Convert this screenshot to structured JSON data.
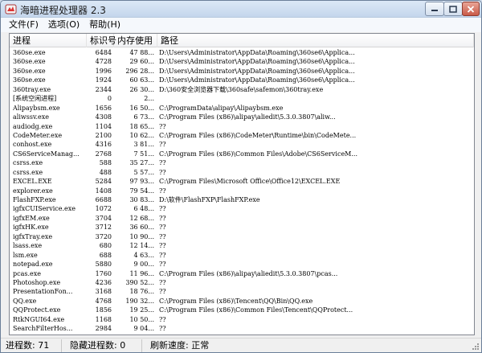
{
  "window": {
    "title": "海暗进程处理器 2.3"
  },
  "menu": {
    "items": [
      "文件(F)",
      "选项(O)",
      "帮助(H)"
    ]
  },
  "columns": {
    "name": "进程",
    "pid": "标识号",
    "mem": "内存使用",
    "path": "路径"
  },
  "rows": [
    {
      "name": "360se.exe",
      "pid": "6484",
      "mem": "47 88...",
      "path": "D:\\Users\\Administrator\\AppData\\Roaming\\360se6\\Applica..."
    },
    {
      "name": "360se.exe",
      "pid": "4728",
      "mem": "29 60...",
      "path": "D:\\Users\\Administrator\\AppData\\Roaming\\360se6\\Applica..."
    },
    {
      "name": "360se.exe",
      "pid": "1996",
      "mem": "296 28...",
      "path": "D:\\Users\\Administrator\\AppData\\Roaming\\360se6\\Applica..."
    },
    {
      "name": "360se.exe",
      "pid": "1924",
      "mem": "60 63...",
      "path": "D:\\Users\\Administrator\\AppData\\Roaming\\360se6\\Applica..."
    },
    {
      "name": "360tray.exe",
      "pid": "2344",
      "mem": "26 30...",
      "path": "D:\\360安全浏览器下载\\360safe\\safemon\\360tray.exe"
    },
    {
      "name": "[系统空闲进程]",
      "pid": "0",
      "mem": "2...",
      "path": ""
    },
    {
      "name": "Alipaybsm.exe",
      "pid": "1656",
      "mem": "16 50...",
      "path": "C:\\ProgramData\\alipay\\Alipaybsm.exe"
    },
    {
      "name": "aliwssv.exe",
      "pid": "4308",
      "mem": "6 73...",
      "path": "C:\\Program Files (x86)\\alipay\\aliedit\\5.3.0.3807\\aliw..."
    },
    {
      "name": "audiodg.exe",
      "pid": "1104",
      "mem": "18 65...",
      "path": "??"
    },
    {
      "name": "CodeMeter.exe",
      "pid": "2100",
      "mem": "10 62...",
      "path": "C:\\Program Files (x86)\\CodeMeter\\Runtime\\bin\\CodeMete..."
    },
    {
      "name": "conhost.exe",
      "pid": "4316",
      "mem": "3 81...",
      "path": "??"
    },
    {
      "name": "CS6ServiceManag...",
      "pid": "2768",
      "mem": "7 51...",
      "path": "C:\\Program Files (x86)\\Common Files\\Adobe\\CS6ServiceM..."
    },
    {
      "name": "csrss.exe",
      "pid": "588",
      "mem": "35 27...",
      "path": "??"
    },
    {
      "name": "csrss.exe",
      "pid": "488",
      "mem": "5 57...",
      "path": "??"
    },
    {
      "name": "EXCEL.EXE",
      "pid": "5284",
      "mem": "97 93...",
      "path": "C:\\Program Files\\Microsoft Office\\Office12\\EXCEL.EXE"
    },
    {
      "name": "explorer.exe",
      "pid": "1408",
      "mem": "79 54...",
      "path": "??"
    },
    {
      "name": "FlashFXP.exe",
      "pid": "6688",
      "mem": "30 83...",
      "path": "D:\\软件\\FlashFXP\\FlashFXP.exe"
    },
    {
      "name": "igfxCUIService.exe",
      "pid": "1072",
      "mem": "6 48...",
      "path": "??"
    },
    {
      "name": "igfxEM.exe",
      "pid": "3704",
      "mem": "12 68...",
      "path": "??"
    },
    {
      "name": "igfxHK.exe",
      "pid": "3712",
      "mem": "36 60...",
      "path": "??"
    },
    {
      "name": "igfxTray.exe",
      "pid": "3720",
      "mem": "10 90...",
      "path": "??"
    },
    {
      "name": "lsass.exe",
      "pid": "680",
      "mem": "12 14...",
      "path": "??"
    },
    {
      "name": "lsm.exe",
      "pid": "688",
      "mem": "4 63...",
      "path": "??"
    },
    {
      "name": "notepad.exe",
      "pid": "5880",
      "mem": "9 00...",
      "path": "??"
    },
    {
      "name": "pcas.exe",
      "pid": "1760",
      "mem": "11 96...",
      "path": "C:\\Program Files (x86)\\alipay\\aliedit\\5.3.0.3807\\pcas..."
    },
    {
      "name": "Photoshop.exe",
      "pid": "4236",
      "mem": "390 52...",
      "path": "??"
    },
    {
      "name": "PresentationFon...",
      "pid": "3168",
      "mem": "18 76...",
      "path": "??"
    },
    {
      "name": "QQ.exe",
      "pid": "4768",
      "mem": "190 32...",
      "path": "C:\\Program Files (x86)\\Tencent\\QQ\\Bin\\QQ.exe"
    },
    {
      "name": "QQProtect.exe",
      "pid": "1856",
      "mem": "19 25...",
      "path": "C:\\Program Files (x86)\\Common Files\\Tencent\\QQProtect..."
    },
    {
      "name": "RtkNGUI64.exe",
      "pid": "1168",
      "mem": "10 50...",
      "path": "??"
    },
    {
      "name": "SearchFilterHos...",
      "pid": "2984",
      "mem": "9 04...",
      "path": "??"
    }
  ],
  "status": {
    "process_count": "进程数: 71",
    "hidden_count": "隐藏进程数: 0",
    "refresh_speed": "刷新速度: 正常"
  },
  "icons": {
    "app": "app-icon",
    "minimize": "minimize-icon",
    "maximize": "maximize-icon",
    "close": "close-icon",
    "grip": "resize-grip-icon"
  },
  "colors": {
    "close_button": "#c95a48",
    "titlebar": "#c4d6ec"
  }
}
